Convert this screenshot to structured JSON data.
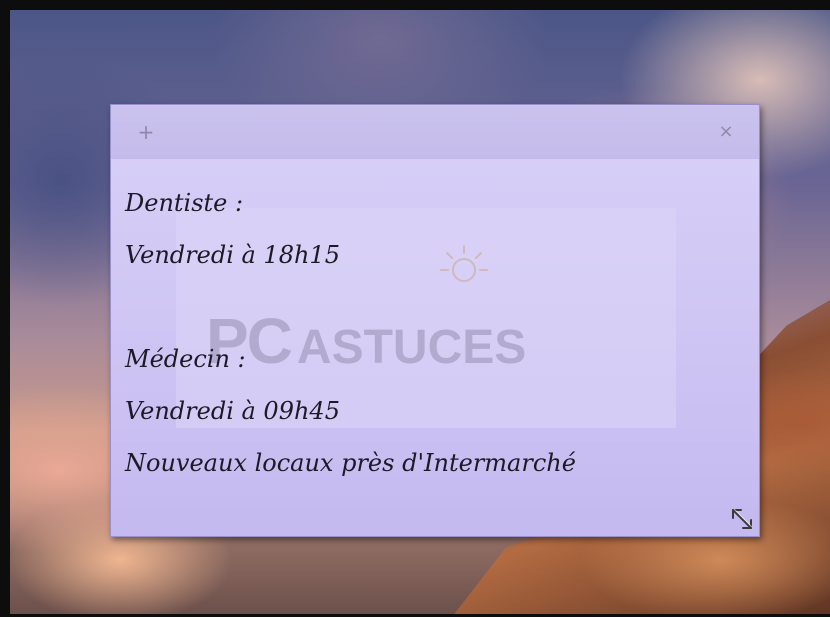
{
  "note": {
    "lines": [
      "Dentiste :",
      "Vendredi à 18h15",
      "",
      "Médecin :",
      "Vendredi à 09h45",
      "Nouveaux locaux près d'Intermarché"
    ],
    "add_glyph": "+",
    "close_glyph": "×",
    "background": "#cfc6f4"
  },
  "watermark": {
    "pc": "PC",
    "astuces": "ASTUCES"
  }
}
